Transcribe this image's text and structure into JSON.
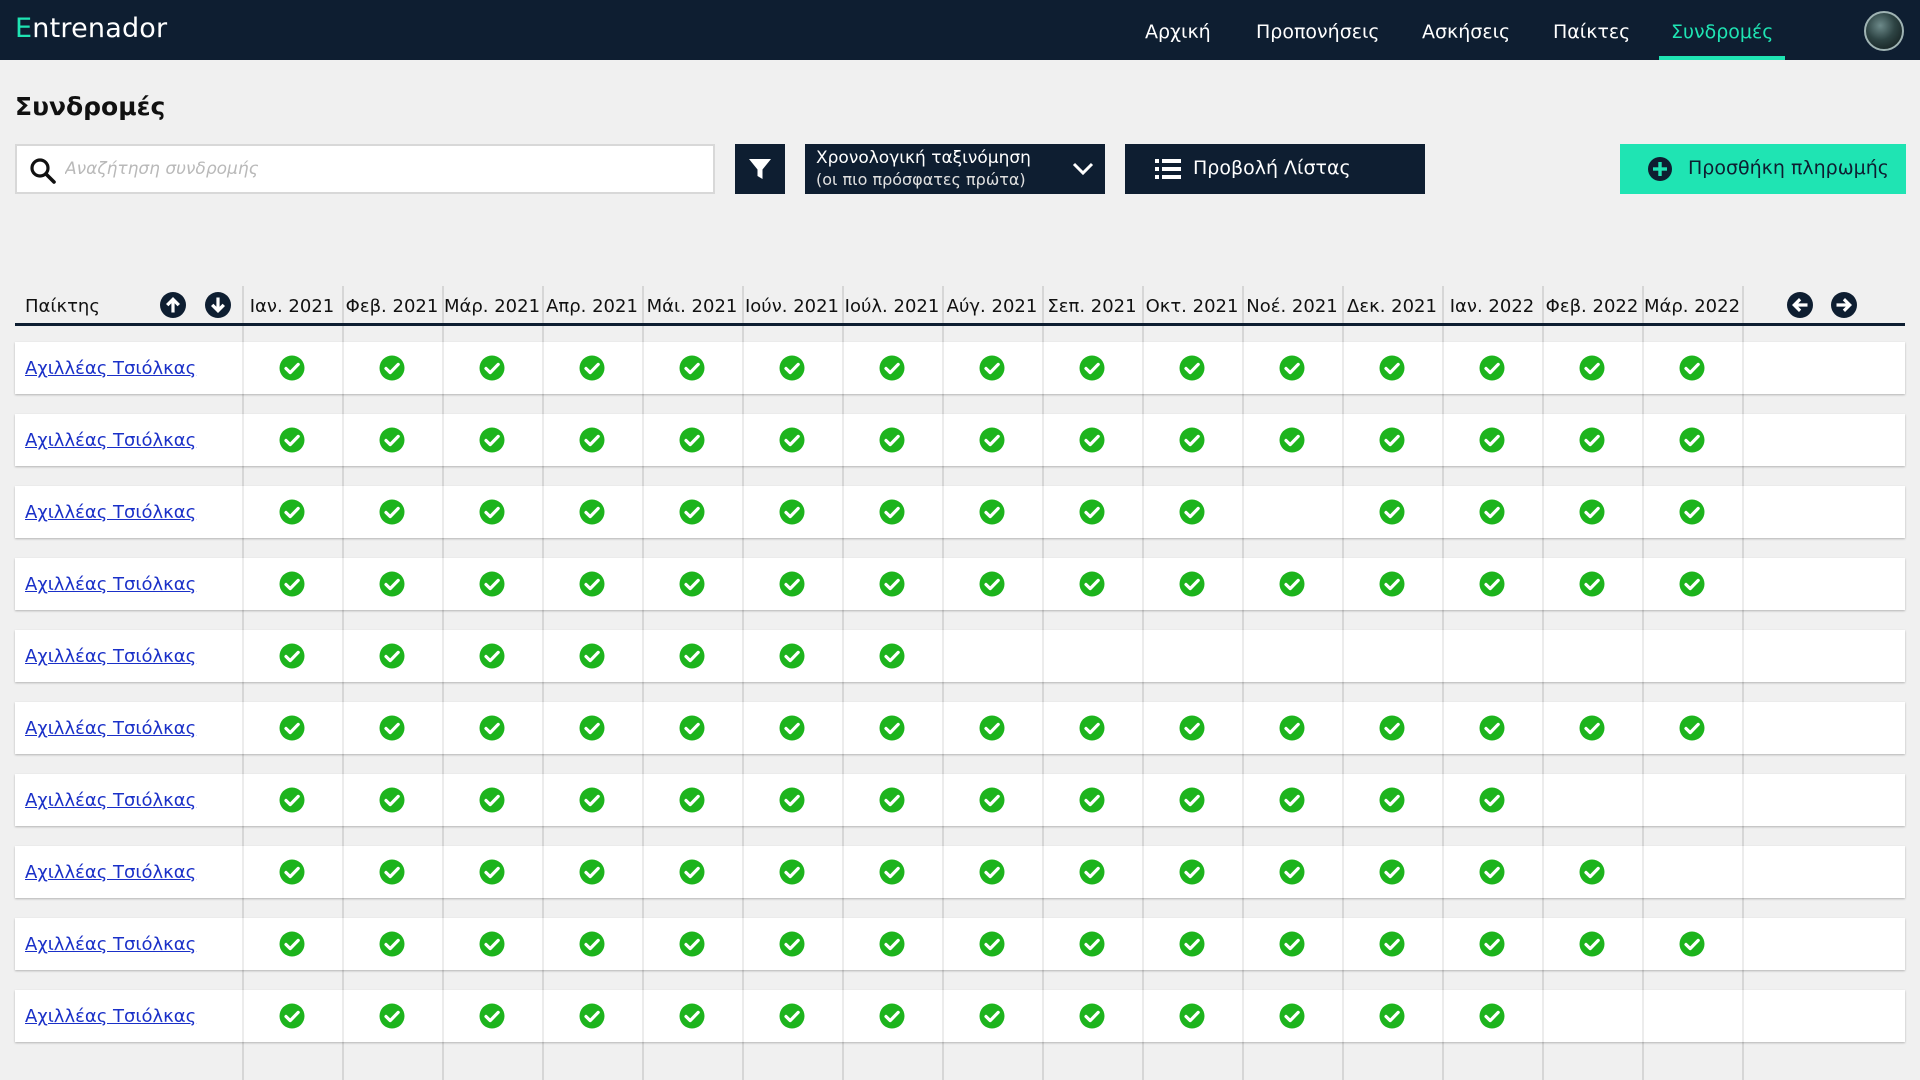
{
  "app": {
    "logo_first": "E",
    "logo_rest": "ntrenador"
  },
  "nav": {
    "items": [
      {
        "label": "Αρχική",
        "name": "nav-home"
      },
      {
        "label": "Προπονήσεις",
        "name": "nav-trainings"
      },
      {
        "label": "Ασκήσεις",
        "name": "nav-exercises"
      },
      {
        "label": "Παίκτες",
        "name": "nav-players"
      },
      {
        "label": "Συνδρομές",
        "name": "nav-subscriptions",
        "active": true
      }
    ]
  },
  "page": {
    "title": "Συνδρομές"
  },
  "toolbar": {
    "search_placeholder": "Αναζήτηση συνδρομής",
    "search_value": "",
    "sort_line1": "Χρονολογική ταξινόμηση",
    "sort_line2": "(οι πιο πρόσφατες πρώτα)",
    "list_view_label": "Προβολή Λίστας",
    "add_payment_label": "Προσθήκη πληρωμής"
  },
  "colors": {
    "navy": "#0e1e31",
    "accent": "#1fe4b3",
    "check": "#1db41d",
    "link": "#1a30c8"
  },
  "table": {
    "player_header": "Παίκτης",
    "months": [
      "Ιαν. 2021",
      "Φεβ. 2021",
      "Μάρ. 2021",
      "Απρ. 2021",
      "Μάι. 2021",
      "Ιούν. 2021",
      "Ιούλ. 2021",
      "Αύγ. 2021",
      "Σεπ. 2021",
      "Οκτ. 2021",
      "Νοέ. 2021",
      "Δεκ. 2021",
      "Ιαν. 2022",
      "Φεβ. 2022",
      "Μάρ. 2022"
    ],
    "rows": [
      {
        "player": "Αχιλλέας Τσιόλκας",
        "paid": [
          1,
          1,
          1,
          1,
          1,
          1,
          1,
          1,
          1,
          1,
          1,
          1,
          1,
          1,
          1
        ]
      },
      {
        "player": "Αχιλλέας Τσιόλκας",
        "paid": [
          1,
          1,
          1,
          1,
          1,
          1,
          1,
          1,
          1,
          1,
          1,
          1,
          1,
          1,
          1
        ]
      },
      {
        "player": "Αχιλλέας Τσιόλκας",
        "paid": [
          1,
          1,
          1,
          1,
          1,
          1,
          1,
          1,
          1,
          1,
          0,
          1,
          1,
          1,
          1
        ]
      },
      {
        "player": "Αχιλλέας Τσιόλκας",
        "paid": [
          1,
          1,
          1,
          1,
          1,
          1,
          1,
          1,
          1,
          1,
          1,
          1,
          1,
          1,
          1
        ]
      },
      {
        "player": "Αχιλλέας Τσιόλκας",
        "paid": [
          1,
          1,
          1,
          1,
          1,
          1,
          1,
          0,
          0,
          0,
          0,
          0,
          0,
          0,
          0
        ]
      },
      {
        "player": "Αχιλλέας Τσιόλκας",
        "paid": [
          1,
          1,
          1,
          1,
          1,
          1,
          1,
          1,
          1,
          1,
          1,
          1,
          1,
          1,
          1
        ]
      },
      {
        "player": "Αχιλλέας Τσιόλκας",
        "paid": [
          1,
          1,
          1,
          1,
          1,
          1,
          1,
          1,
          1,
          1,
          1,
          1,
          1,
          0,
          0
        ]
      },
      {
        "player": "Αχιλλέας Τσιόλκας",
        "paid": [
          1,
          1,
          1,
          1,
          1,
          1,
          1,
          1,
          1,
          1,
          1,
          1,
          1,
          1,
          0
        ]
      },
      {
        "player": "Αχιλλέας Τσιόλκας",
        "paid": [
          1,
          1,
          1,
          1,
          1,
          1,
          1,
          1,
          1,
          1,
          1,
          1,
          1,
          1,
          1
        ]
      },
      {
        "player": "Αχιλλέας Τσιόλκας",
        "paid": [
          1,
          1,
          1,
          1,
          1,
          1,
          1,
          1,
          1,
          1,
          1,
          1,
          1,
          0,
          0
        ]
      }
    ]
  }
}
